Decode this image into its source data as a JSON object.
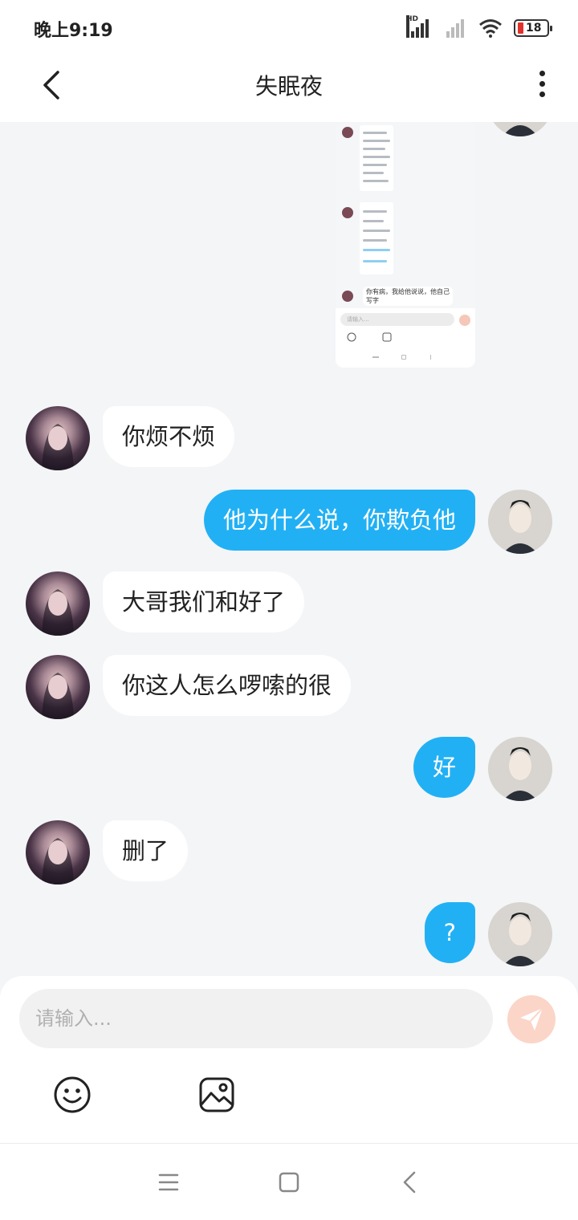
{
  "status_bar": {
    "time": "晚上9:19",
    "network_label": "HD",
    "battery_level": "18",
    "icons": [
      "signal-icon",
      "signal-off-icon",
      "wifi-icon",
      "battery-icon"
    ]
  },
  "header": {
    "title": "失眠夜",
    "icons": [
      "back-arrow-icon",
      "more-vertical-icon"
    ]
  },
  "shared_image": {
    "caption_text": "你有病，我给他说说，他自己写字",
    "input_placeholder": "请输入..."
  },
  "messages": [
    {
      "side": "left",
      "text": "你烦不烦"
    },
    {
      "side": "right",
      "text": "他为什么说，你欺负他"
    },
    {
      "side": "left",
      "text": "大哥我们和好了"
    },
    {
      "side": "left",
      "text": "你这人怎么啰嗦的很"
    },
    {
      "side": "right",
      "text": "好"
    },
    {
      "side": "left",
      "text": "删了"
    },
    {
      "side": "right",
      "text": "?"
    }
  ],
  "composer": {
    "placeholder": "请输入...",
    "icons": [
      "send-icon",
      "emoji-icon",
      "image-icon"
    ]
  },
  "nav_bar": {
    "icons": [
      "menu-icon",
      "home-icon",
      "back-icon"
    ]
  },
  "colors": {
    "accent": "#22b0f4",
    "background": "#f3f5f7",
    "send_button": "#fbd5c8"
  }
}
